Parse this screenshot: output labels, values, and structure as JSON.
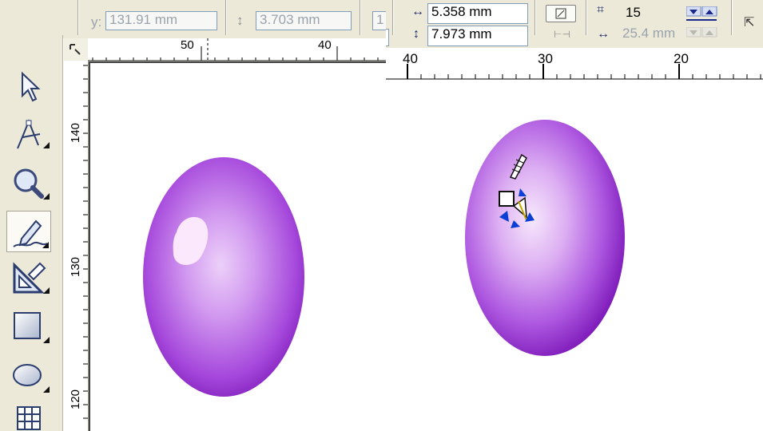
{
  "left_panel": {
    "property_bar": {
      "y_label": "y:",
      "y_value": "131.91 mm",
      "h_value": "3.703 mm",
      "partial_value": "1"
    },
    "ruler_top_ticks": [
      "50",
      "40"
    ],
    "ruler_left_ticks": [
      "140",
      "130",
      "120"
    ],
    "toolbox": [
      "pick-tool",
      "shape-tool",
      "zoom-tool",
      "freehand-tool",
      "dimension-tool",
      "rectangle-tool",
      "ellipse-tool",
      "graph-paper-tool"
    ],
    "active_tool": "freehand-tool"
  },
  "right_panel": {
    "property_bar": {
      "width_value": "5.358 mm",
      "height_value": "7.973 mm",
      "count_value": "15",
      "spacing_value": "25.4 mm"
    },
    "ruler_top_ticks": [
      "40",
      "30",
      "20"
    ]
  },
  "colors": {
    "egg_dark": "#7d1fb8",
    "egg_mid": "#b45ae0",
    "egg_light": "#e9c6f7",
    "highlight": "#fbe8fd",
    "ui_face": "#ece9d8",
    "selection_blue": "#0a3fd6"
  }
}
